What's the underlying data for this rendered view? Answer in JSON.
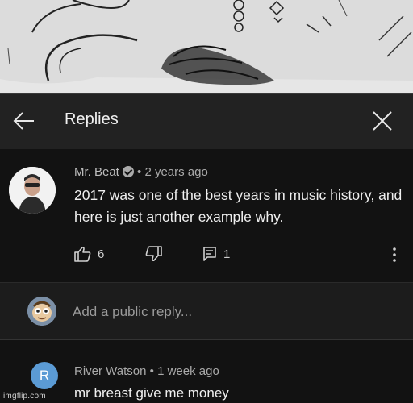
{
  "header": {
    "title": "Replies"
  },
  "comment": {
    "author": "Mr. Beat",
    "time": "2 years ago",
    "text": "2017 was one of the best years in music history, and here is just another example why.",
    "likes": "6",
    "replies": "1"
  },
  "reply_box": {
    "placeholder": "Add a public reply..."
  },
  "reply": {
    "avatar_letter": "R",
    "author": "River Watson",
    "time": "1 week ago",
    "text": "mr breast give me  money"
  },
  "watermark": "imgflip.com",
  "icons": [
    "back-arrow-icon",
    "close-icon",
    "verified-icon",
    "thumbs-up-icon",
    "thumbs-down-icon",
    "reply-icon",
    "more-icon"
  ]
}
